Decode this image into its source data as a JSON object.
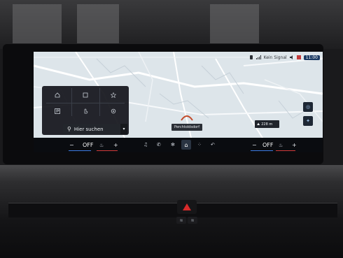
{
  "statusbar": {
    "network_label": "Kein Signal",
    "time": "11:00"
  },
  "map": {
    "place_label": "Perchtoldsdorf",
    "distance": "228 m"
  },
  "menu": {
    "search_label": "Hier suchen"
  },
  "dock": {
    "left_temp": "OFF",
    "right_temp": "OFF",
    "minus": "−",
    "plus": "+"
  },
  "colors": {
    "accent_blue": "#3c7be0",
    "accent_red": "#d23a3a",
    "hazard_red": "#d62a2a"
  }
}
